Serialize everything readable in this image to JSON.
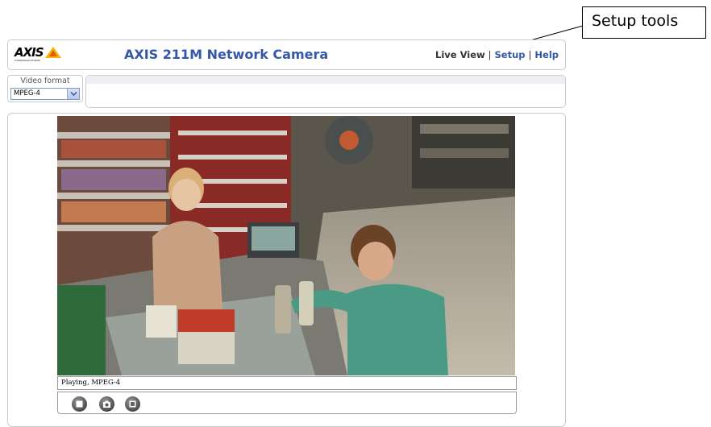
{
  "callout": {
    "label": "Setup tools"
  },
  "header": {
    "logo_text": "AXIS",
    "logo_tagline": "COMMUNICATIONS",
    "title": "AXIS 211M Network Camera",
    "nav": [
      {
        "label": "Live View"
      },
      {
        "label": "Setup"
      },
      {
        "label": "Help"
      }
    ]
  },
  "video_format": {
    "label": "Video format",
    "selected": "MPEG-4"
  },
  "player": {
    "status": "Playing, MPEG-4",
    "controls": [
      {
        "icon": "stop-icon"
      },
      {
        "icon": "snapshot-camera-icon"
      },
      {
        "icon": "view-full-screen-icon"
      }
    ]
  },
  "colors": {
    "title_blue": "#3358a8",
    "panel_border": "#c9cbd2",
    "logo_yellow": "#f5b400"
  }
}
